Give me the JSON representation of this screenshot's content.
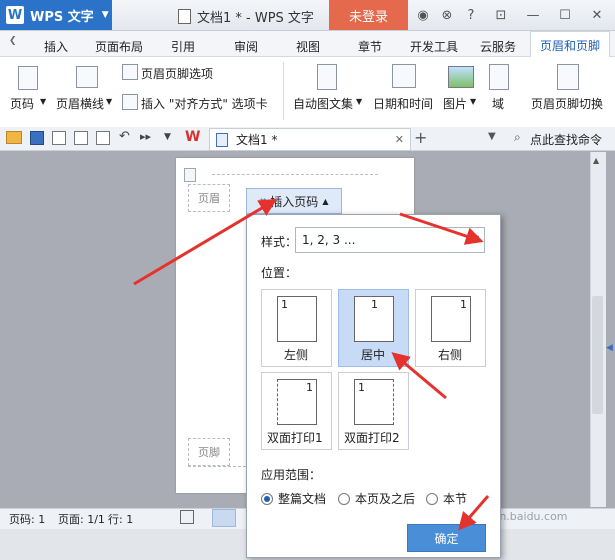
{
  "titlebar": {
    "app_name": "WPS 文字",
    "logo_letter": "W",
    "document_title": "文档1 * - WPS 文字",
    "login_label": "未登录"
  },
  "tabs": [
    "插入",
    "页面布局",
    "引用",
    "审阅",
    "视图",
    "章节",
    "开发工具",
    "云服务"
  ],
  "active_tab": "页眉和页脚",
  "ribbon": {
    "header_footer_options": "页眉页脚选项",
    "page_number": "页码",
    "header_line": "页眉横线",
    "insert_align_tab": "插入 \"对齐方式\" 选项卡",
    "autotext": "自动图文集",
    "date_time": "日期和时间",
    "picture": "图片",
    "field": "域",
    "header_footer_switch": "页眉页脚切换"
  },
  "quickbar": {
    "doc_tab_label": "文档1 *",
    "search_label": "点此查找命令"
  },
  "document": {
    "header_label": "页眉",
    "footer_label": "页脚",
    "insert_page_number": "插入页码"
  },
  "popup": {
    "style_label": "样式：",
    "style_value": "1, 2, 3 ...",
    "position_label": "位置：",
    "positions": [
      {
        "name": "左侧",
        "digit": "1"
      },
      {
        "name": "居中",
        "digit": "1"
      },
      {
        "name": "右侧",
        "digit": "1"
      },
      {
        "name": "双面打印1",
        "digit": "1"
      },
      {
        "name": "双面打印2",
        "digit": "1"
      }
    ],
    "scope_label": "应用范围：",
    "scopes": [
      "整篇文档",
      "本页及之后",
      "本节"
    ],
    "selected_scope": "整篇文档",
    "ok_label": "确定"
  },
  "statusbar": {
    "page_num": "页码: 1",
    "page_of": "页面: 1/1",
    "line": "行: 1"
  },
  "watermark": "jingyan.baidu.com",
  "colors": {
    "brand_blue": "#2b73c8",
    "login_orange": "#e5694d",
    "annotation_red": "#e5322d",
    "ok_button": "#4a8ed8"
  }
}
